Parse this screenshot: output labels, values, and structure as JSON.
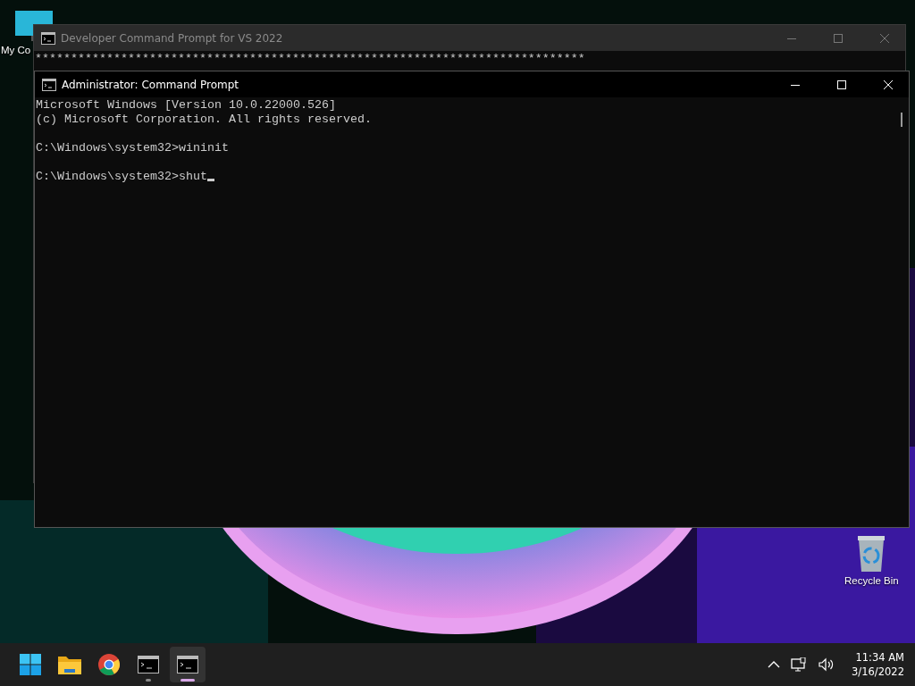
{
  "desktop_icons": [
    {
      "kind": "computer",
      "label": "My Co"
    },
    {
      "kind": "recycle",
      "label": "Recycle Bin"
    }
  ],
  "background_window": {
    "title": "Developer Command Prompt for VS 2022",
    "lines": [
      "*****************************************************************************"
    ]
  },
  "window": {
    "title": "Administrator: Command Prompt",
    "blocks": [
      [
        "Microsoft Windows [Version 10.0.22000.526]",
        "(c) Microsoft Corporation. All rights reserved."
      ],
      [
        "C:\\Windows\\system32>wininit"
      ],
      [
        "C:\\Windows\\system32>shut"
      ]
    ],
    "cursor": true
  },
  "taskbar": {
    "items": [
      {
        "kind": "start",
        "running": false,
        "active": false
      },
      {
        "kind": "folder",
        "running": false,
        "active": false
      },
      {
        "kind": "browser",
        "running": false,
        "active": false
      },
      {
        "kind": "terminal",
        "running": true,
        "active": false
      },
      {
        "kind": "terminal",
        "running": true,
        "active": true
      }
    ],
    "time": "11:34 AM",
    "date": "3/16/2022"
  }
}
